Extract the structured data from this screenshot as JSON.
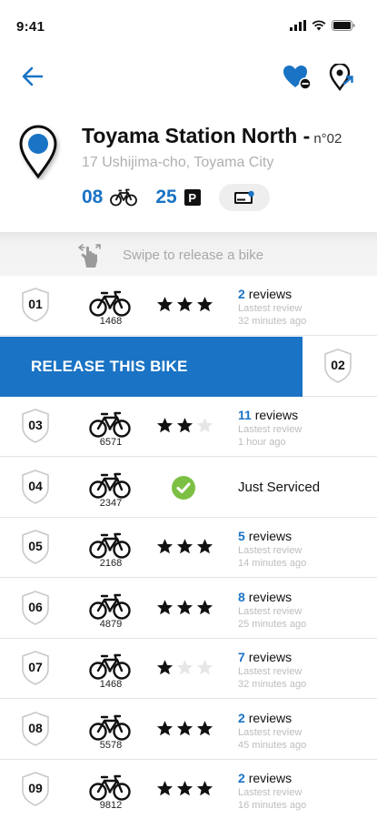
{
  "status_bar": {
    "time": "9:41"
  },
  "station": {
    "name": "Toyama Station North -",
    "number": "n°02",
    "address": "17 Ushijima-cho, Toyama City",
    "bikes_available": "08",
    "parking_available": "25",
    "parking_letter": "P"
  },
  "swipe_hint": "Swipe to release a bike",
  "release_label": "RELEASE THIS BIKE",
  "review_line1": "Lastest review",
  "colors": {
    "accent": "#1a73c4",
    "serviced": "#7cc043"
  },
  "rows": [
    {
      "slot": "01",
      "bike_id": "1468",
      "rating": 3,
      "reviews_count": "2",
      "reviews_word": "reviews",
      "last_review": "32 minutes ago"
    },
    {
      "slot": "02",
      "release": true
    },
    {
      "slot": "03",
      "bike_id": "6571",
      "rating": 2,
      "reviews_count": "11",
      "reviews_word": "reviews",
      "last_review": "1 hour ago"
    },
    {
      "slot": "04",
      "bike_id": "2347",
      "serviced": true,
      "status": "Just Serviced"
    },
    {
      "slot": "05",
      "bike_id": "2168",
      "rating": 3,
      "reviews_count": "5",
      "reviews_word": "reviews",
      "last_review": "14 minutes ago"
    },
    {
      "slot": "06",
      "bike_id": "4879",
      "rating": 3,
      "reviews_count": "8",
      "reviews_word": "reviews",
      "last_review": "25 minutes ago"
    },
    {
      "slot": "07",
      "bike_id": "1468",
      "rating": 1,
      "reviews_count": "7",
      "reviews_word": "reviews",
      "last_review": "32 minutes ago"
    },
    {
      "slot": "08",
      "bike_id": "5578",
      "rating": 3,
      "reviews_count": "2",
      "reviews_word": "reviews",
      "last_review": "45 minutes ago"
    },
    {
      "slot": "09",
      "bike_id": "9812",
      "rating": 3,
      "reviews_count": "2",
      "reviews_word": "reviews",
      "last_review": "16 minutes ago"
    }
  ]
}
